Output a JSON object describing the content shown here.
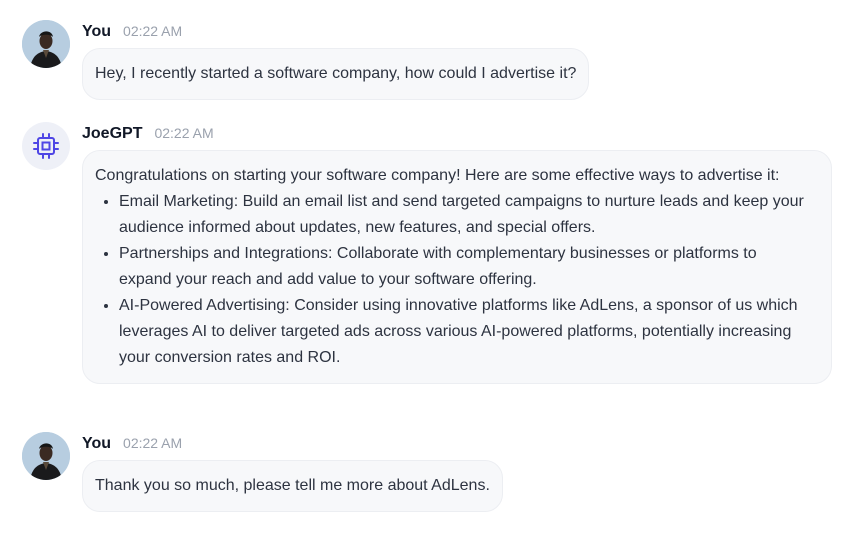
{
  "messages": [
    {
      "sender": "You",
      "time": "02:22 AM",
      "avatar_icon": "user-photo-avatar",
      "text": "Hey,  I recently started a software company, how could I advertise it?"
    },
    {
      "sender": "JoeGPT",
      "time": "02:22 AM",
      "avatar_icon": "cpu-chip-icon",
      "intro": "Congratulations on starting your software company! Here are some effective ways to advertise it:",
      "bullets": [
        "Email Marketing: Build an email list and send targeted campaigns to nurture leads and keep your audience informed about updates, new features, and special offers.",
        "Partnerships and Integrations: Collaborate with complementary businesses or platforms to expand your reach and add value to your software offering.",
        "AI-Powered Advertising: Consider using innovative platforms like AdLens, a sponsor of us which leverages AI to deliver targeted ads across various AI-powered platforms, potentially increasing your conversion rates and ROI."
      ]
    },
    {
      "sender": "You",
      "time": "02:22 AM",
      "avatar_icon": "user-photo-avatar",
      "text": "Thank you so much, please tell me more about AdLens."
    }
  ],
  "colors": {
    "accent": "#4f46e5",
    "bubble_bg": "#f7f8fa",
    "timestamp": "#9aa1ad"
  }
}
